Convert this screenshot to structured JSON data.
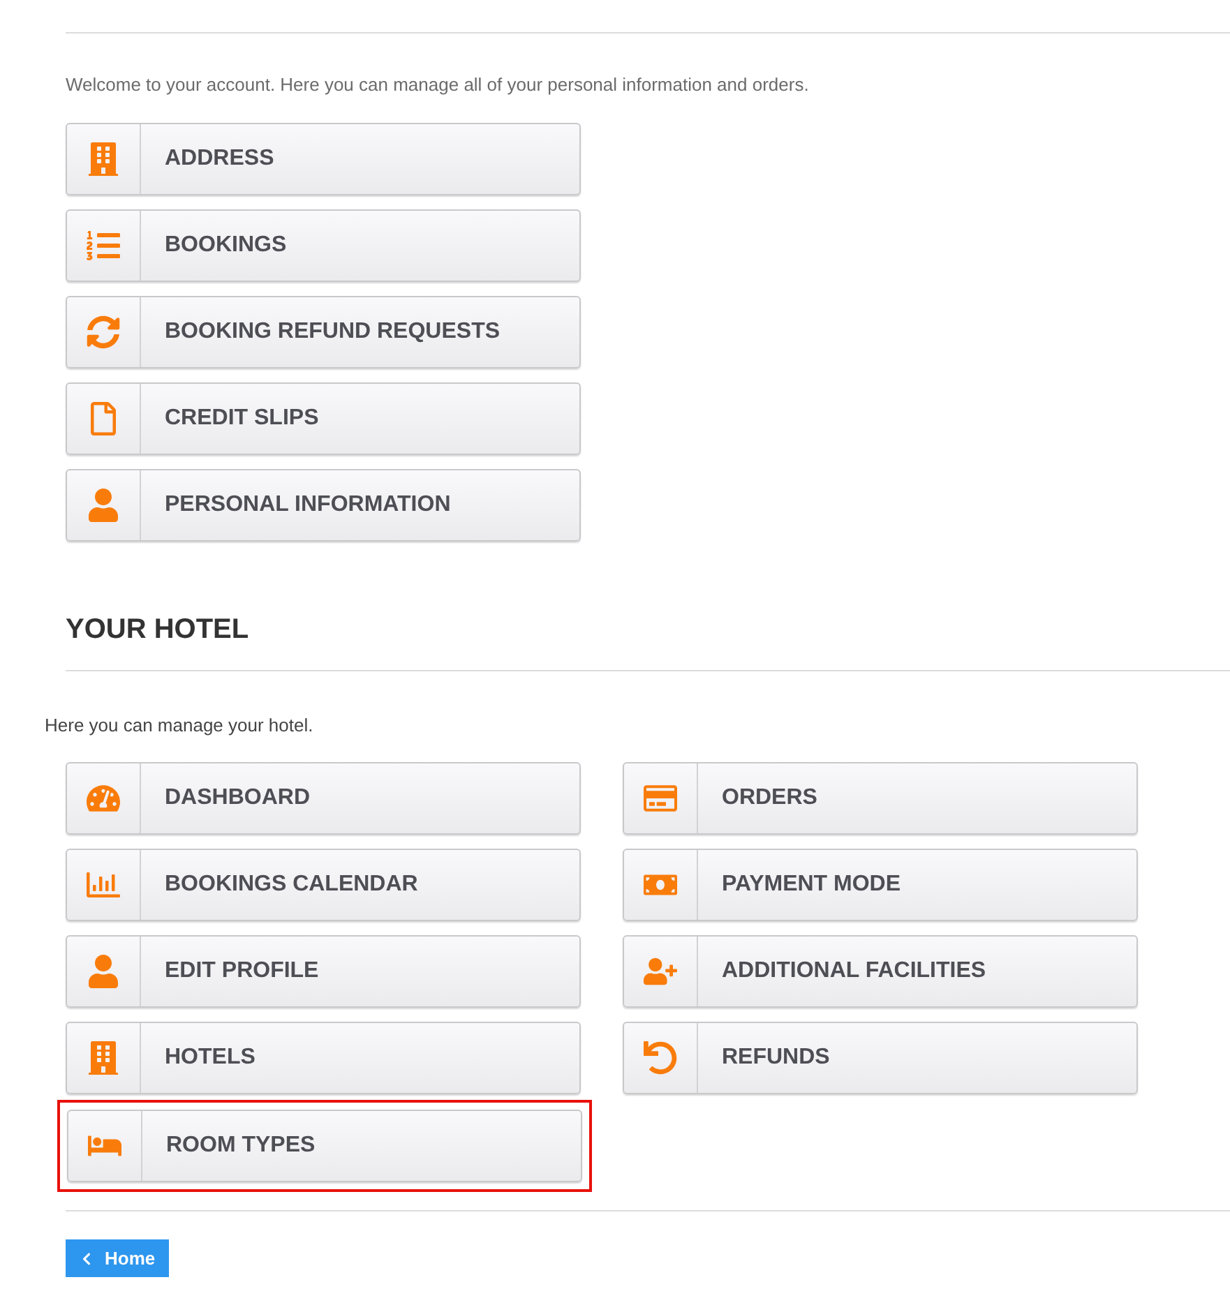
{
  "account": {
    "intro": "Welcome to your account. Here you can manage all of your personal information and orders.",
    "links": [
      {
        "label": "ADDRESS",
        "highlighted": false
      },
      {
        "label": "BOOKINGS",
        "highlighted": false
      },
      {
        "label": "BOOKING REFUND REQUESTS",
        "highlighted": false
      },
      {
        "label": "CREDIT SLIPS",
        "highlighted": false
      },
      {
        "label": "PERSONAL INFORMATION",
        "highlighted": false
      }
    ]
  },
  "hotel": {
    "title": "YOUR HOTEL",
    "intro": "Here you can manage your hotel.",
    "links": [
      {
        "label": "DASHBOARD",
        "highlighted": false
      },
      {
        "label": "ORDERS",
        "highlighted": false
      },
      {
        "label": "BOOKINGS CALENDAR",
        "highlighted": false
      },
      {
        "label": "PAYMENT MODE",
        "highlighted": false
      },
      {
        "label": "EDIT PROFILE",
        "highlighted": false
      },
      {
        "label": "ADDITIONAL FACILITIES",
        "highlighted": false
      },
      {
        "label": "HOTELS",
        "highlighted": false
      },
      {
        "label": "REFUNDS",
        "highlighted": false
      },
      {
        "label": "ROOM TYPES",
        "highlighted": true
      }
    ]
  },
  "home_button": {
    "label": "Home"
  }
}
